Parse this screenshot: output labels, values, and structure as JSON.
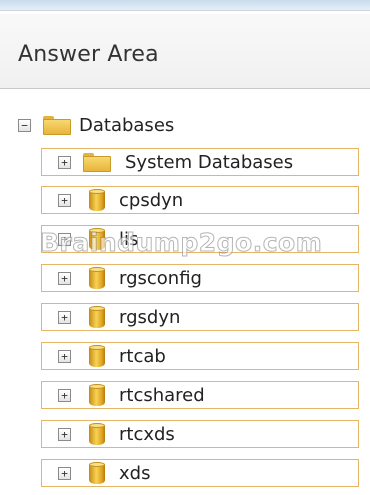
{
  "header": {
    "title": "Answer Area"
  },
  "tree": {
    "root": {
      "expander": "−",
      "label": "Databases"
    },
    "items": [
      {
        "expander": "+",
        "label": "System Databases",
        "icon": "folder-icon"
      },
      {
        "expander": "+",
        "label": "cpsdyn",
        "icon": "database-icon"
      },
      {
        "expander": "+",
        "label": "lis",
        "icon": "database-icon"
      },
      {
        "expander": "+",
        "label": "rgsconfig",
        "icon": "database-icon"
      },
      {
        "expander": "+",
        "label": "rgsdyn",
        "icon": "database-icon"
      },
      {
        "expander": "+",
        "label": "rtcab",
        "icon": "database-icon"
      },
      {
        "expander": "+",
        "label": "rtcshared",
        "icon": "database-icon"
      },
      {
        "expander": "+",
        "label": "rtcxds",
        "icon": "database-icon"
      },
      {
        "expander": "+",
        "label": "xds",
        "icon": "database-icon"
      }
    ]
  },
  "watermark": "Braindump2go.com",
  "colors": {
    "item_border": "#e7b567",
    "folder": "#f3c955",
    "database": "#e8b030"
  }
}
